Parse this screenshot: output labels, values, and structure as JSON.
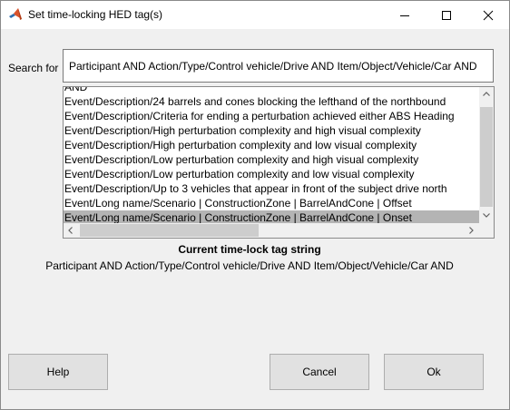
{
  "window": {
    "title": "Set time-locking HED tag(s)"
  },
  "search": {
    "label": "Search for",
    "value": "Participant AND Action/Type/Control vehicle/Drive AND Item/Object/Vehicle/Car AND"
  },
  "list": {
    "items": [
      "AND",
      "Event/Description/24 barrels and cones blocking the lefthand of the northbound",
      "Event/Description/Criteria for ending a perturbation achieved either ABS Heading",
      "Event/Description/High perturbation complexity and high visual complexity",
      "Event/Description/High perturbation complexity and low visual complexity",
      "Event/Description/Low perturbation complexity and high visual complexity",
      "Event/Description/Low perturbation complexity and low visual complexity",
      "Event/Description/Up to 3 vehicles that appear in front of the subject drive north",
      "Event/Long name/Scenario | ConstructionZone | BarrelAndCone | Offset",
      "Event/Long name/Scenario | ConstructionZone | BarrelAndCone | Onset"
    ],
    "selected_index": 9
  },
  "current": {
    "heading": "Current time-lock tag string",
    "value": "Participant AND Action/Type/Control vehicle/Drive AND Item/Object/Vehicle/Car AND"
  },
  "buttons": {
    "help": "Help",
    "cancel": "Cancel",
    "ok": "Ok"
  },
  "icons": {
    "app": "matlab-icon",
    "minimize": "minimize-icon",
    "maximize": "maximize-icon",
    "close": "close-icon"
  },
  "colors": {
    "selected_row": "#b4b4b4",
    "window_bg": "#f0f0f0"
  }
}
